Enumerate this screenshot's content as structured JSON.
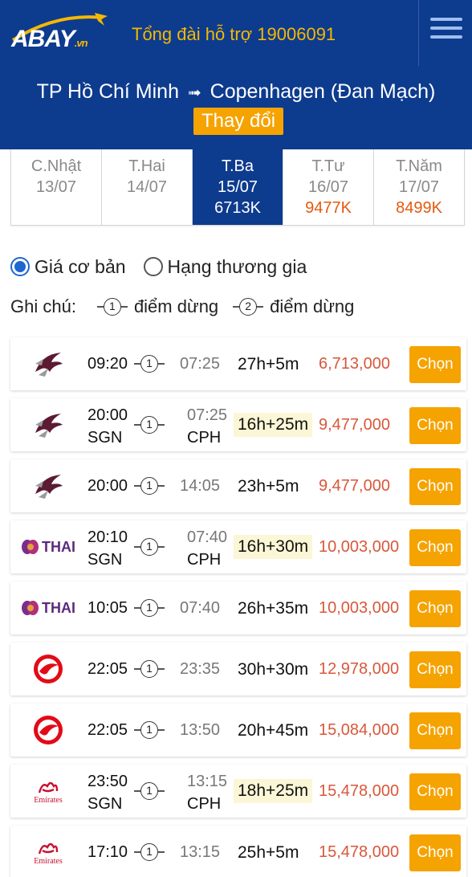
{
  "header": {
    "logo_text": "BAY",
    "logo_prefix": "A",
    "logo_suffix": ".vn",
    "hotline": "Tổng đài hỗ trợ 19006091",
    "menu_icon": "hamburger-icon"
  },
  "route": {
    "origin": "TP Hồ Chí Minh",
    "arrow": "➟",
    "destination": "Copenhagen (Đan Mạch)",
    "change_label": "Thay đổi"
  },
  "date_tabs": [
    {
      "day": "C.Nhật",
      "date": "13/07",
      "price": ""
    },
    {
      "day": "T.Hai",
      "date": "14/07",
      "price": ""
    },
    {
      "day": "T.Ba",
      "date": "15/07",
      "price": "6713K",
      "active": true
    },
    {
      "day": "T.Tư",
      "date": "16/07",
      "price": "9477K"
    },
    {
      "day": "T.Năm",
      "date": "17/07",
      "price": "8499K"
    }
  ],
  "fare_options": {
    "basic": "Giá cơ bản",
    "business": "Hạng thương gia",
    "selected": "basic"
  },
  "legend": {
    "label": "Ghi chú:",
    "one_stop_num": "1",
    "one_stop_text": "điểm dừng",
    "two_stop_num": "2",
    "two_stop_text": "điểm dừng"
  },
  "flights": [
    {
      "airline": "qatar",
      "dep": "09:20",
      "arr": "07:25",
      "dep_code": "",
      "arr_code": "",
      "stops": "1",
      "duration": "27h+5m",
      "highlight": false,
      "price": "6,713,000",
      "button": "Chọn"
    },
    {
      "airline": "qatar",
      "dep": "20:00",
      "arr": "07:25",
      "dep_code": "SGN",
      "arr_code": "CPH",
      "stops": "1",
      "duration": "16h+25m",
      "highlight": true,
      "price": "9,477,000",
      "button": "Chọn"
    },
    {
      "airline": "qatar",
      "dep": "20:00",
      "arr": "14:05",
      "dep_code": "",
      "arr_code": "",
      "stops": "1",
      "duration": "23h+5m",
      "highlight": false,
      "price": "9,477,000",
      "button": "Chọn"
    },
    {
      "airline": "thai",
      "dep": "20:10",
      "arr": "07:40",
      "dep_code": "SGN",
      "arr_code": "CPH",
      "stops": "1",
      "duration": "16h+30m",
      "highlight": true,
      "price": "10,003,000",
      "button": "Chọn"
    },
    {
      "airline": "thai",
      "dep": "10:05",
      "arr": "07:40",
      "dep_code": "",
      "arr_code": "",
      "stops": "1",
      "duration": "26h+35m",
      "highlight": false,
      "price": "10,003,000",
      "button": "Chọn"
    },
    {
      "airline": "turkish",
      "dep": "22:05",
      "arr": "23:35",
      "dep_code": "",
      "arr_code": "",
      "stops": "1",
      "duration": "30h+30m",
      "highlight": false,
      "price": "12,978,000",
      "button": "Chọn"
    },
    {
      "airline": "turkish",
      "dep": "22:05",
      "arr": "13:50",
      "dep_code": "",
      "arr_code": "",
      "stops": "1",
      "duration": "20h+45m",
      "highlight": false,
      "price": "15,084,000",
      "button": "Chọn"
    },
    {
      "airline": "emirates",
      "dep": "23:50",
      "arr": "13:15",
      "dep_code": "SGN",
      "arr_code": "CPH",
      "stops": "1",
      "duration": "18h+25m",
      "highlight": true,
      "price": "15,478,000",
      "button": "Chọn"
    },
    {
      "airline": "emirates",
      "dep": "17:10",
      "arr": "13:15",
      "dep_code": "",
      "arr_code": "",
      "stops": "1",
      "duration": "25h+5m",
      "highlight": false,
      "price": "15,478,000",
      "button": "Chọn"
    }
  ],
  "logo_texts": {
    "thai": "THAI",
    "emirates": "Emirates"
  },
  "colors": {
    "brand_blue": "#0d3b8e",
    "accent_orange": "#f5a300",
    "price_red": "#d9573a",
    "highlight": "#fbf6d6"
  }
}
